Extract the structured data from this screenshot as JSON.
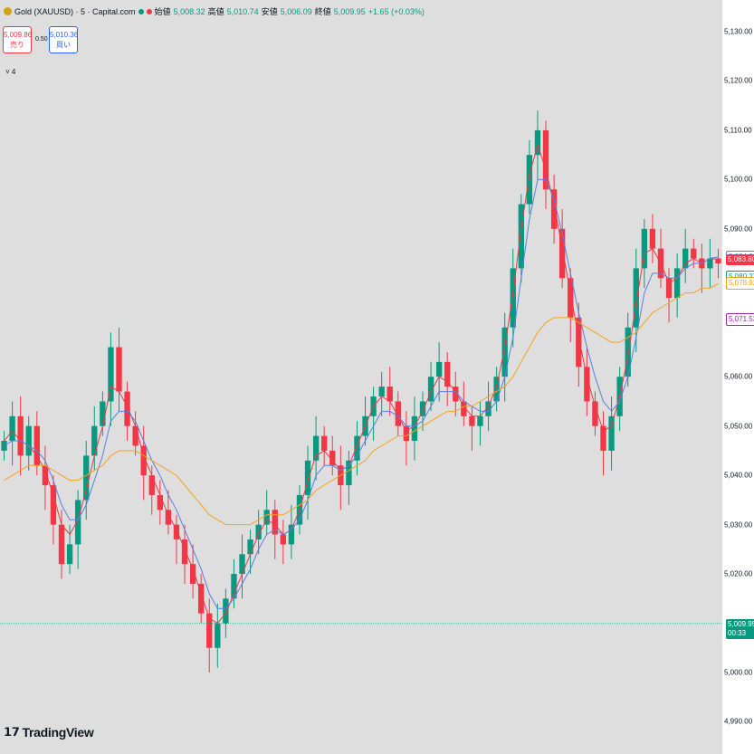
{
  "header": {
    "symbol": "Gold (XAUUSD) · 5 · Capital.com",
    "open_label": "始値",
    "open": "5,008.32",
    "high_label": "高値",
    "high": "5,010.74",
    "low_label": "安値",
    "low": "5,006.09",
    "close_label": "終値",
    "close": "5,009.95",
    "change": "+1.65 (+0.03%)"
  },
  "trade": {
    "sell_price": "5,009.86",
    "sell_label": "売り",
    "spread": "0.50",
    "buy_price": "5,010.36",
    "buy_label": "買い"
  },
  "indicator_toggle": "˅ 4",
  "logo": {
    "mark": "𝟭𝟳",
    "text": "TradingView"
  },
  "price_scale": {
    "ticks": [
      "5,130.00",
      "5,120.00",
      "5,110.00",
      "5,100.00",
      "5,090.00",
      "5,060.00",
      "5,050.00",
      "5,040.00",
      "5,030.00",
      "5,020.00",
      "5,000.00",
      "4,990.00"
    ],
    "tags": {
      "ma_blue": "5,084.31",
      "ma_red": "5,083.80",
      "ma_teal": "5,080.27",
      "ma_orange": "5,078.92",
      "ma_purple": "5,071.53",
      "last_price": "5,009.95",
      "countdown": "00:33"
    }
  },
  "colors": {
    "up": "#089981",
    "down": "#f23645",
    "ma_fast": "#f23645",
    "ma_mid": "#5b7ee5",
    "ma_slow": "#f7a21b",
    "last_line": "#089981",
    "purple": "#9c27b0",
    "background": "#dedede"
  },
  "chart_data": {
    "type": "candlestick",
    "symbol": "XAUUSD",
    "interval": "5",
    "ylim": [
      4990,
      5135
    ],
    "last_close": 5009.95,
    "series": [
      {
        "name": "price",
        "values": [
          5047,
          5052,
          5044,
          5050,
          5042,
          5038,
          5030,
          5022,
          5026,
          5035,
          5044,
          5050,
          5055,
          5066,
          5057,
          5050,
          5046,
          5040,
          5036,
          5033,
          5030,
          5027,
          5022,
          5018,
          5012,
          5005,
          5010,
          5015,
          5020,
          5024,
          5027,
          5030,
          5033,
          5028,
          5026,
          5030,
          5036,
          5043,
          5048,
          5045,
          5042,
          5038,
          5043,
          5048,
          5052,
          5056,
          5058,
          5055,
          5050,
          5047,
          5052,
          5055,
          5060,
          5063,
          5058,
          5055,
          5052,
          5050,
          5052,
          5055,
          5060,
          5070,
          5082,
          5095,
          5105,
          5110,
          5098,
          5090,
          5080,
          5072,
          5062,
          5055,
          5050,
          5045,
          5052,
          5060,
          5070,
          5082,
          5090,
          5086,
          5080,
          5076,
          5082,
          5086,
          5084,
          5082,
          5084,
          5083
        ]
      },
      {
        "name": "ma_fast",
        "values": [
          5047,
          5049,
          5047,
          5046,
          5044,
          5041,
          5036,
          5030,
          5028,
          5031,
          5037,
          5044,
          5050,
          5058,
          5057,
          5054,
          5050,
          5044,
          5040,
          5036,
          5032,
          5029,
          5025,
          5021,
          5016,
          5011,
          5010,
          5012,
          5016,
          5020,
          5024,
          5028,
          5031,
          5030,
          5028,
          5029,
          5033,
          5039,
          5044,
          5045,
          5043,
          5041,
          5042,
          5046,
          5050,
          5054,
          5056,
          5055,
          5052,
          5049,
          5050,
          5053,
          5057,
          5060,
          5059,
          5057,
          5054,
          5052,
          5052,
          5054,
          5058,
          5066,
          5077,
          5090,
          5101,
          5107,
          5102,
          5095,
          5086,
          5077,
          5068,
          5060,
          5054,
          5049,
          5050,
          5056,
          5064,
          5075,
          5085,
          5086,
          5083,
          5079,
          5080,
          5083,
          5084,
          5083,
          5084,
          5083.8
        ]
      },
      {
        "name": "ma_mid",
        "values": [
          5046,
          5047,
          5047,
          5046,
          5045,
          5043,
          5039,
          5034,
          5031,
          5031,
          5034,
          5039,
          5044,
          5051,
          5053,
          5053,
          5051,
          5047,
          5043,
          5040,
          5036,
          5033,
          5029,
          5025,
          5021,
          5016,
          5013,
          5013,
          5015,
          5018,
          5021,
          5025,
          5028,
          5029,
          5028,
          5029,
          5031,
          5035,
          5040,
          5042,
          5042,
          5041,
          5042,
          5044,
          5047,
          5050,
          5053,
          5053,
          5052,
          5050,
          5050,
          5051,
          5054,
          5057,
          5057,
          5057,
          5055,
          5054,
          5053,
          5053,
          5055,
          5060,
          5068,
          5080,
          5092,
          5100,
          5100,
          5096,
          5089,
          5081,
          5073,
          5066,
          5060,
          5055,
          5053,
          5055,
          5060,
          5068,
          5077,
          5081,
          5081,
          5080,
          5080,
          5082,
          5083,
          5083,
          5084,
          5084.3
        ]
      },
      {
        "name": "ma_slow",
        "values": [
          5039,
          5040,
          5041,
          5042,
          5042,
          5042,
          5041,
          5040,
          5039,
          5039,
          5040,
          5041,
          5042,
          5044,
          5045,
          5045,
          5045,
          5044,
          5043,
          5042,
          5041,
          5040,
          5038,
          5036,
          5034,
          5032,
          5031,
          5030,
          5030,
          5030,
          5030,
          5031,
          5032,
          5032,
          5032,
          5033,
          5034,
          5035,
          5037,
          5038,
          5039,
          5040,
          5041,
          5042,
          5043,
          5045,
          5046,
          5047,
          5048,
          5048,
          5049,
          5050,
          5051,
          5052,
          5053,
          5053,
          5054,
          5054,
          5055,
          5056,
          5057,
          5058,
          5060,
          5063,
          5066,
          5069,
          5071,
          5072,
          5072,
          5072,
          5071,
          5070,
          5069,
          5068,
          5067,
          5067,
          5068,
          5069,
          5071,
          5073,
          5074,
          5075,
          5076,
          5077,
          5077,
          5078,
          5078,
          5078.9
        ]
      }
    ]
  }
}
